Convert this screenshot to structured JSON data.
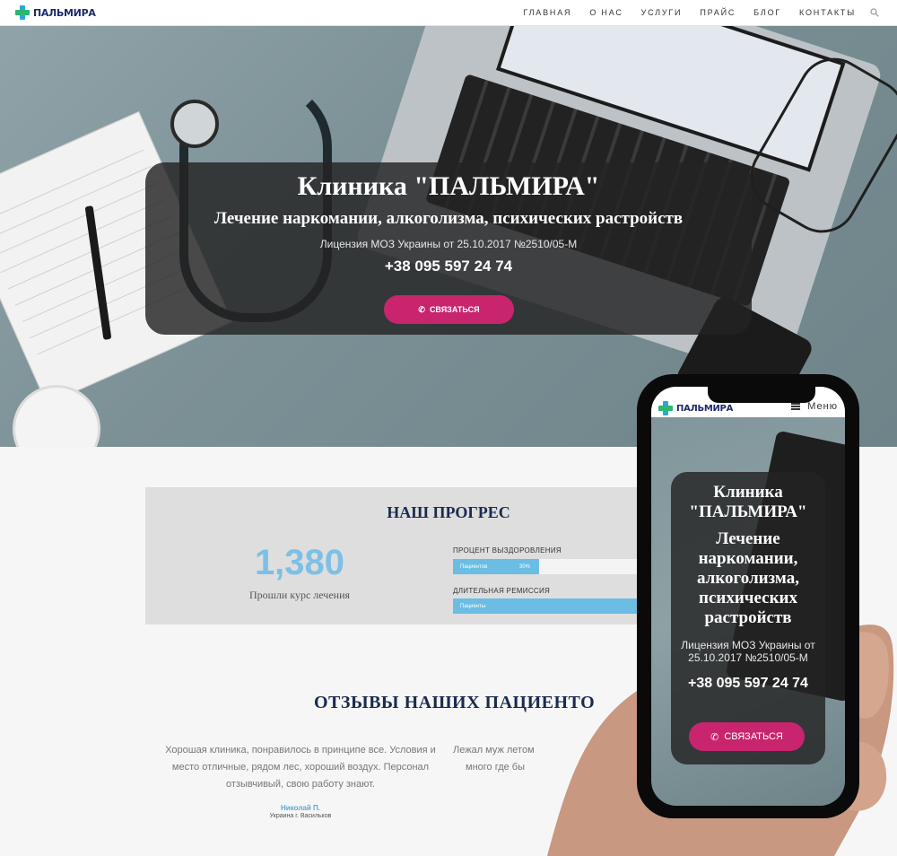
{
  "brand": {
    "logo_text": "ПАЛЬМИРА"
  },
  "nav": {
    "items": [
      "ГЛАВНАЯ",
      "О НАС",
      "УСЛУГИ",
      "ПРАЙС",
      "БЛОГ",
      "КОНТАКТЫ"
    ]
  },
  "hero": {
    "title": "Клиника \"ПАЛЬМИРА\"",
    "subtitle": "Лечение наркомании, алкоголизма, психических растройств",
    "license": "Лицензия МОЗ Украины от 25.10.2017 №2510/05-М",
    "phone": "+38 095 597 24 74",
    "button_label": "СВЯЗАТЬСЯ"
  },
  "progress": {
    "title": "НАШ ПРОГРЕС",
    "counter_value": "1,380",
    "counter_label": "Прошли курс лечения",
    "bars": [
      {
        "label": "ПРОЦЕНТ ВЫЗДОРОВЛЕНИЯ",
        "fill_text": "Пациентов",
        "percent_text": "30%",
        "value": 0.4
      },
      {
        "label": "ДЛИТЕЛЬНАЯ РЕМИССИЯ",
        "fill_text": "Пациенты",
        "percent_text": "",
        "value": 0.88
      }
    ]
  },
  "reviews": {
    "title": "ОТЗЫВЫ НАШИХ ПАЦИЕНТО",
    "items": [
      {
        "text": "Хорошая клиника, понравилось в принципе все. Условия и место отличные, рядом лес, хороший воздух. Персонал отзывчивый, свою работу знают.",
        "author": "Николай П.",
        "location": "Украина г. Васильков"
      },
      {
        "text_line1": "Лежал муж летом",
        "text_line2": "много где бы"
      }
    ]
  },
  "mobile": {
    "menu_label": "Меню",
    "title": "Клиника \"ПАЛЬМИРА\"",
    "subtitle": "Лечение наркомании, алкоголизма, психических растройств",
    "license": "Лицензия МОЗ Украины от 25.10.2017 №2510/05-М",
    "phone": "+38 095 597 24 74",
    "button_label": "СВЯЗАТЬСЯ"
  },
  "colors": {
    "accent": "#c8256e",
    "counter": "#7dc0e6",
    "heading": "#1b2a4e",
    "bar": "#6bbde3"
  }
}
